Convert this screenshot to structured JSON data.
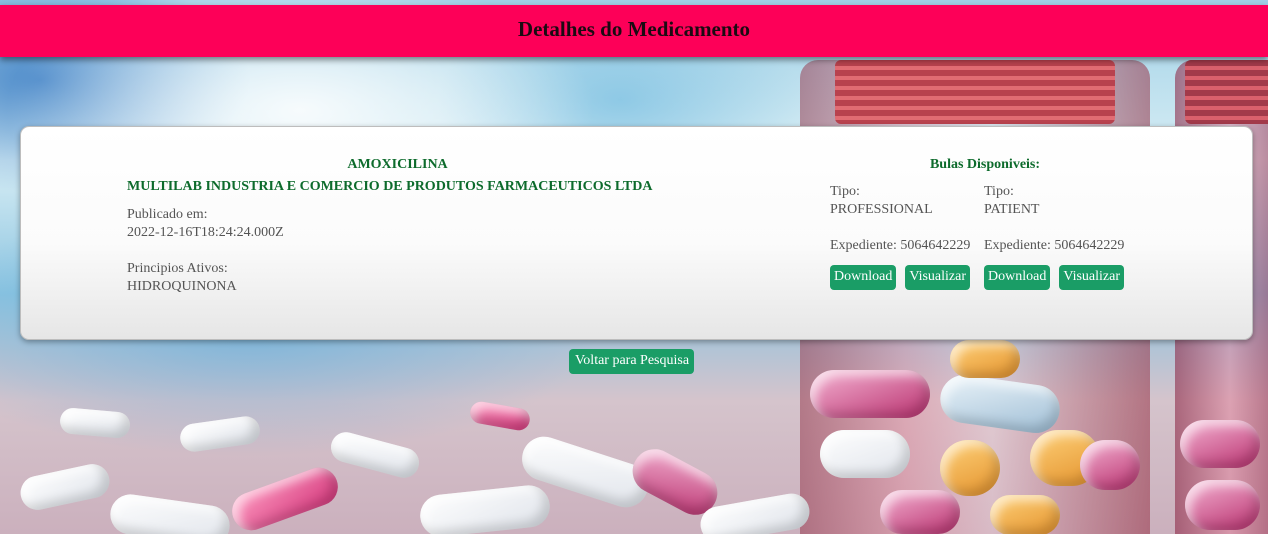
{
  "header": {
    "title": "Detalhes do Medicamento"
  },
  "medicamento": {
    "nome": "AMOXICILINA",
    "empresa": "MULTILAB INDUSTRIA E COMERCIO DE PRODUTOS FARMACEUTICOS LTDA",
    "publicado_label": "Publicado em:",
    "publicado_valor": "2022-12-16T18:24:24.000Z",
    "principios_label": "Principios Ativos:",
    "principios_valor": "HIDROQUINONA"
  },
  "bulas": {
    "title": "Bulas Disponiveis:",
    "items": [
      {
        "tipo_label": "Tipo:",
        "tipo_valor": "PROFESSIONAL",
        "expediente": "Expediente: 5064642229",
        "download_label": "Download",
        "visualizar_label": "Visualizar"
      },
      {
        "tipo_label": "Tipo:",
        "tipo_valor": "PATIENT",
        "expediente": "Expediente: 5064642229",
        "download_label": "Download",
        "visualizar_label": "Visualizar"
      }
    ]
  },
  "actions": {
    "back_label": "Voltar para Pesquisa"
  },
  "colors": {
    "header_bg": "#fd0058",
    "accent_green": "#1a9d66",
    "title_green": "#0d6b2c"
  }
}
